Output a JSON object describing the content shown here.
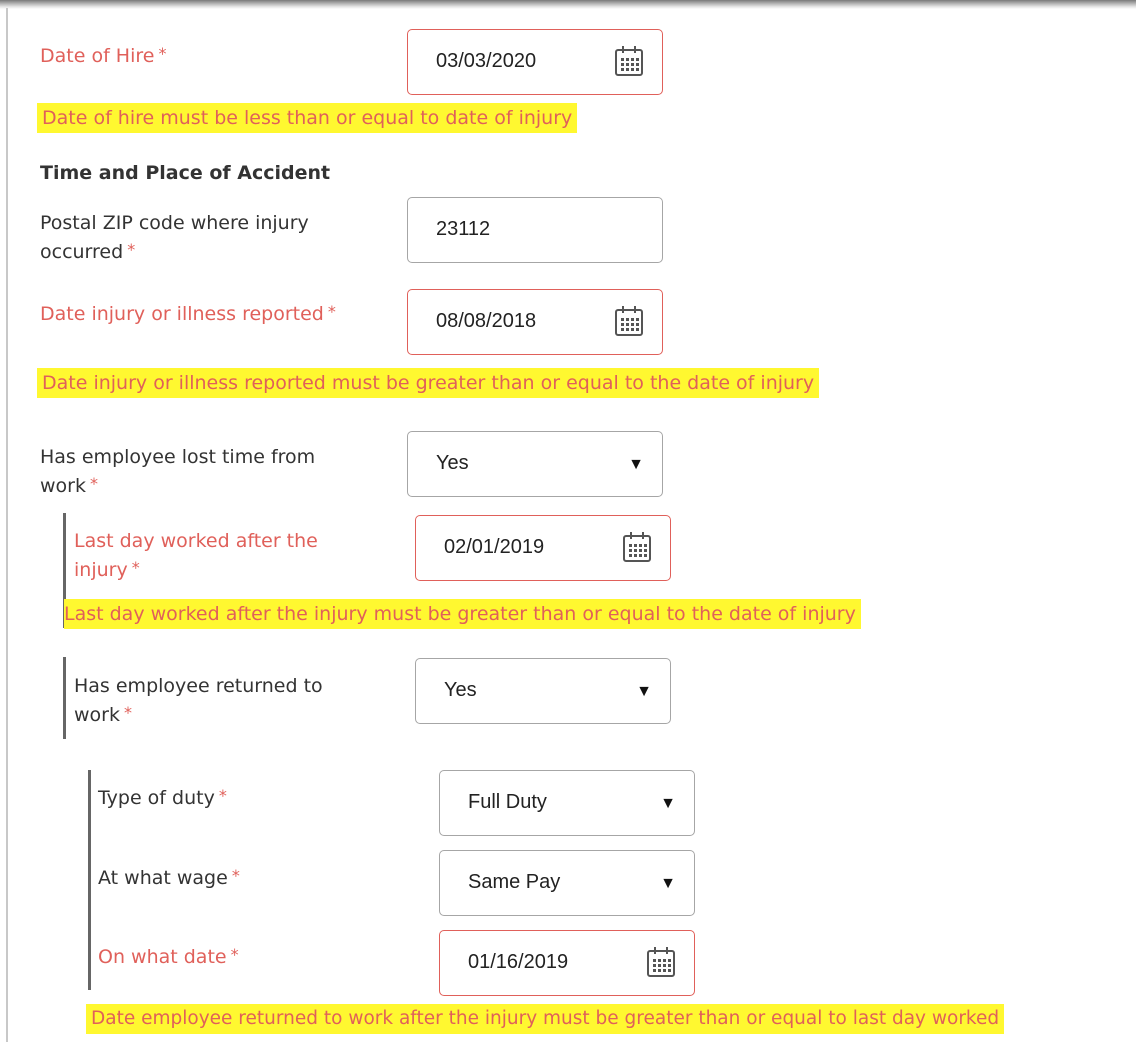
{
  "required_marker": "*",
  "date_of_hire": {
    "label": "Date of Hire",
    "value": "03/03/2020",
    "error": "Date of hire must be less than or equal to date of injury"
  },
  "section_heading": "Time and Place of Accident",
  "postal_zip": {
    "label_line1": "Postal ZIP code where injury",
    "label_line2": "occurred",
    "value": "23112"
  },
  "date_reported": {
    "label": "Date injury or illness reported",
    "value": "08/08/2018",
    "error": "Date injury or illness reported must be greater than or equal to the date of injury"
  },
  "lost_time": {
    "label_line1": "Has employee lost time from",
    "label_line2": "work",
    "value": "Yes"
  },
  "last_day_worked": {
    "label_line1": "Last day worked after the",
    "label_line2": "injury",
    "value": "02/01/2019",
    "error": "Last day worked after the injury must be greater than or equal to the date of injury"
  },
  "returned_to_work": {
    "label_line1": "Has employee returned to",
    "label_line2": "work",
    "value": "Yes"
  },
  "type_of_duty": {
    "label": "Type of duty",
    "value": "Full Duty"
  },
  "wage": {
    "label": "At what wage",
    "value": "Same Pay"
  },
  "return_date": {
    "label": "On what date",
    "value": "01/16/2019",
    "error": "Date employee returned to work after the injury must be greater than or equal to last day worked"
  },
  "icons": {
    "calendar": "calendar-icon",
    "dropdown": "dropdown-caret-icon"
  },
  "colors": {
    "error": "#e0605a",
    "highlight": "#fff830",
    "border": "#a6a6a6"
  }
}
